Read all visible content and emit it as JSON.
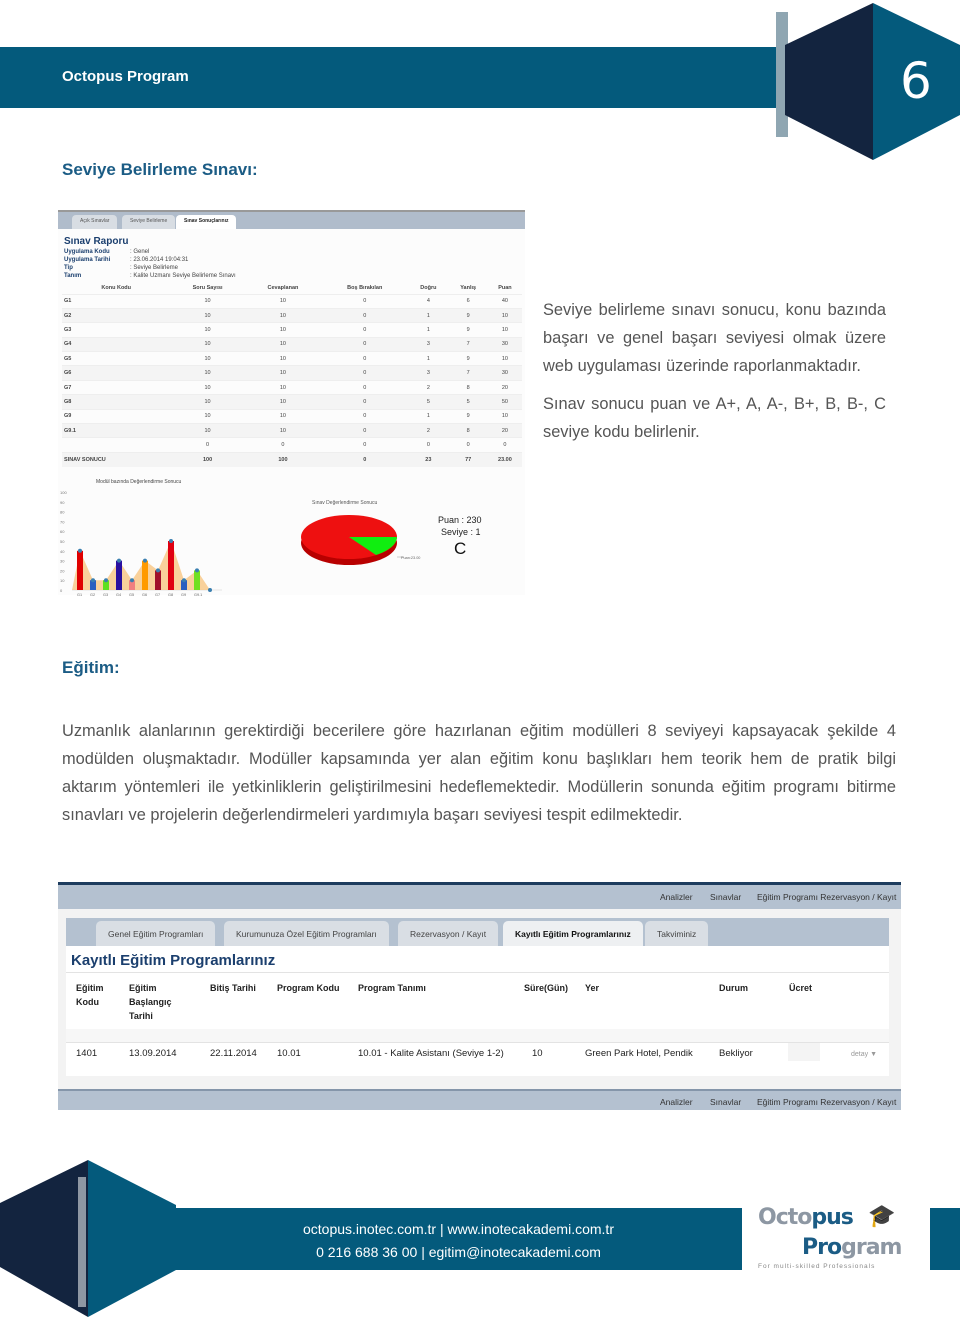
{
  "header": {
    "title": "Octopus Program",
    "page_number": "6"
  },
  "section1": {
    "heading": "Seviye Belirleme Sınavı:",
    "paragraphs": [
      "Seviye belirleme sınavı sonucu, konu bazında başarı ve genel başarı seviyesi olmak üzere web uygulaması üzerinde raporlanmaktadır.",
      "Sınav sonucu puan ve A+, A, A-,  B+, B, B-, C seviye kodu belirlenir."
    ],
    "report": {
      "tabs": [
        "Açık Sınavlar",
        "Seviye Belirleme",
        "Sınav Sonuçlarınız"
      ],
      "active_tab": 2,
      "title": "Sınav Raporu",
      "meta": [
        {
          "label": "Uygulama Kodu",
          "value": ": Genel"
        },
        {
          "label": "Uygulama Tarihi",
          "value": ": 23.06.2014 19:04:31"
        },
        {
          "label": "Tip",
          "value": ": Seviye Belirleme"
        },
        {
          "label": "Tanım",
          "value": ": Kalite Uzmanı Seviye Belirleme Sınavı"
        }
      ],
      "columns": [
        "Konu Kodu",
        "Soru Sayısı",
        "Cevaplanan",
        "Boş Bırakılan",
        "Doğru",
        "Yanlış",
        "Puan"
      ],
      "rows": [
        [
          "G1",
          "10",
          "10",
          "0",
          "4",
          "6",
          "40"
        ],
        [
          "G2",
          "10",
          "10",
          "0",
          "1",
          "9",
          "10"
        ],
        [
          "G3",
          "10",
          "10",
          "0",
          "1",
          "9",
          "10"
        ],
        [
          "G4",
          "10",
          "10",
          "0",
          "3",
          "7",
          "30"
        ],
        [
          "G5",
          "10",
          "10",
          "0",
          "1",
          "9",
          "10"
        ],
        [
          "G6",
          "10",
          "10",
          "0",
          "3",
          "7",
          "30"
        ],
        [
          "G7",
          "10",
          "10",
          "0",
          "2",
          "8",
          "20"
        ],
        [
          "G8",
          "10",
          "10",
          "0",
          "5",
          "5",
          "50"
        ],
        [
          "G9",
          "10",
          "10",
          "0",
          "1",
          "9",
          "10"
        ],
        [
          "G9.1",
          "10",
          "10",
          "0",
          "2",
          "8",
          "20"
        ],
        [
          "",
          "0",
          "0",
          "0",
          "0",
          "0",
          "0"
        ],
        [
          "SINAV SONUCU",
          "100",
          "100",
          "0",
          "23",
          "77",
          "23.00"
        ]
      ],
      "bar_chart": {
        "title": "Modül bazında Değerlendirme Sonucu",
        "categories": [
          "G1",
          "G2",
          "G3",
          "G4",
          "G5",
          "G6",
          "G7",
          "G8",
          "G9",
          "G9.1",
          ""
        ],
        "values": [
          40,
          10,
          10,
          30,
          10,
          30,
          20,
          50,
          10,
          20,
          0
        ],
        "colors": [
          "#e00000",
          "#2a5fc0",
          "#5ee020",
          "#2a10a0",
          "#f08080",
          "#ff9a00",
          "#a0102a",
          "#e00010",
          "#2a5fc0",
          "#70e020",
          "#3a6fa0"
        ],
        "area_color": "#f8c98a",
        "yticks": [
          "100",
          "90",
          "80",
          "70",
          "60",
          "50",
          "40",
          "30",
          "20",
          "10",
          "0"
        ],
        "ylim": [
          0,
          100
        ]
      },
      "pie_chart": {
        "title": "Sınav Değerlendirme Sonucu",
        "slice_label": "Puan:23.00",
        "colors": [
          "#ee1010",
          "#10ee10"
        ]
      },
      "score": {
        "puan": "Puan : 230",
        "seviye": "Seviye : 1",
        "grade": "C"
      }
    }
  },
  "section2": {
    "heading": "Eğitim:",
    "paragraph": "Uzmanlık alanlarının gerektirdiği becerilere göre hazırlanan eğitim modülleri 8 seviyeyi kapsayacak şekilde 4 modülden oluşmaktadır. Modüller kapsamında yer alan eğitim konu başlıkları hem teorik hem de pratik bilgi aktarım yöntemleri ile yetkinliklerin geliştirilmesini hedeflemektedir. Modüllerin sonunda eğitim programı bitirme sınavları ve projelerin değerlendirmeleri yardımıyla başarı seviyesi tespit edilmektedir.",
    "app": {
      "topnav": [
        "Analizler",
        "Sınavlar",
        "Eğitim Programı Rezervasyon / Kayıt"
      ],
      "tabs": [
        "Genel Eğitim Programları",
        "Kurumunuza Özel Eğitim Programları",
        "Rezervasyon / Kayıt",
        "Kayıtlı Eğitim Programlarınız",
        "Takviminiz"
      ],
      "active_tab": 3,
      "title": "Kayıtlı Eğitim Programlarınız",
      "columns": [
        "Eğitim Kodu",
        "Eğitim Başlangıç Tarihi",
        "Bitiş Tarihi",
        "Program Kodu",
        "Program Tanımı",
        "Süre(Gün)",
        "Yer",
        "Durum",
        "Ücret"
      ],
      "row": [
        "1401",
        "13.09.2014",
        "22.11.2014",
        "10.01",
        "10.01 - Kalite Asistanı (Seviye 1-2)",
        "10",
        "Green Park Hotel, Pendik",
        "Bekliyor",
        ""
      ],
      "detail_link": "detay"
    }
  },
  "footer": {
    "link1": "octopus.inotec.com.tr",
    "link2": "www.inotecakademi.com.tr",
    "phone": "0 216 688 36 00",
    "email": "egitim@inotecakademi.com",
    "logo_line1": "Octopus",
    "logo_line2": "Program",
    "logo_tagline": "For multi-skilled Professionals",
    "brand_color": "#045a7c",
    "dark_color": "#13243f"
  }
}
